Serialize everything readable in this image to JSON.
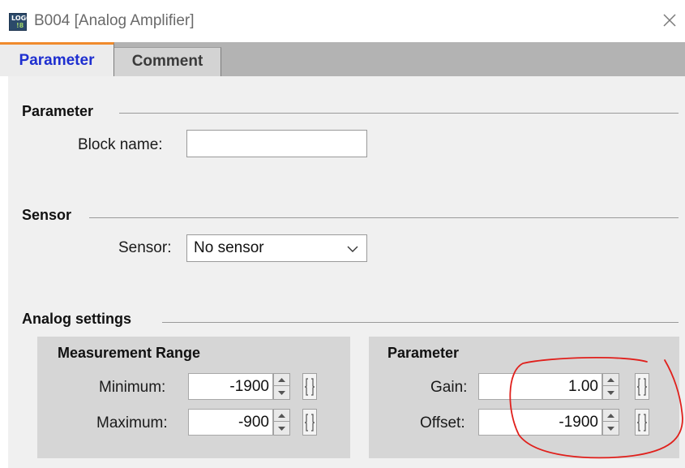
{
  "window": {
    "title": "B004 [Analog Amplifier]",
    "app_icon_top": "LOGO",
    "app_icon_bottom": "!8"
  },
  "tabs": [
    {
      "label": "Parameter",
      "active": true
    },
    {
      "label": "Comment",
      "active": false
    }
  ],
  "parameter_group": {
    "title": "Parameter",
    "block_name_label": "Block name:",
    "block_name_value": ""
  },
  "sensor_group": {
    "title": "Sensor",
    "sensor_label": "Sensor:",
    "sensor_value": "No sensor"
  },
  "analog_settings": {
    "title": "Analog settings",
    "measurement_range": {
      "title": "Measurement Range",
      "minimum_label": "Minimum:",
      "minimum_value": "-1900",
      "maximum_label": "Maximum:",
      "maximum_value": "-900"
    },
    "parameter": {
      "title": "Parameter",
      "gain_label": "Gain:",
      "gain_value": "1.00",
      "offset_label": "Offset:",
      "offset_value": "-1900"
    }
  },
  "colors": {
    "active_tab_text": "#1e2fd0",
    "active_tab_accent": "#f08a2c",
    "annotation": "#e0201c"
  }
}
